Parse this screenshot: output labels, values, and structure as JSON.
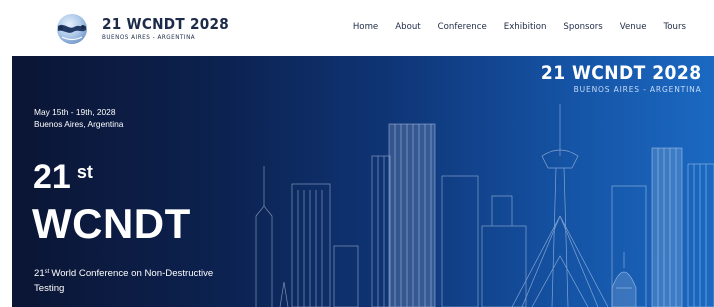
{
  "header": {
    "logo": {
      "title": "21 WCNDT 2028",
      "subtitle": "BUENOS AIRES - ARGENTINA"
    },
    "nav": [
      {
        "label": "Home"
      },
      {
        "label": "About"
      },
      {
        "label": "Conference"
      },
      {
        "label": "Exhibition"
      },
      {
        "label": "Sponsors"
      },
      {
        "label": "Venue"
      },
      {
        "label": "Tours"
      }
    ]
  },
  "hero": {
    "brand_title": "21 WCNDT 2028",
    "brand_subtitle": "BUENOS AIRES - ARGENTINA",
    "dates": "May 15th - 19th, 2028",
    "location": "Buenos Aires, Argentina",
    "edition_number": "21",
    "edition_suffix": "st",
    "acronym": "WCNDT",
    "desc_number": "21",
    "desc_suffix": "st",
    "desc_text": "World Conference on Non-Destructive Testing",
    "background_color": "#0f3678",
    "skyline_color": "#dbe9fb"
  },
  "icons": {
    "logo_mark": "globe-ndt-logo-icon"
  }
}
